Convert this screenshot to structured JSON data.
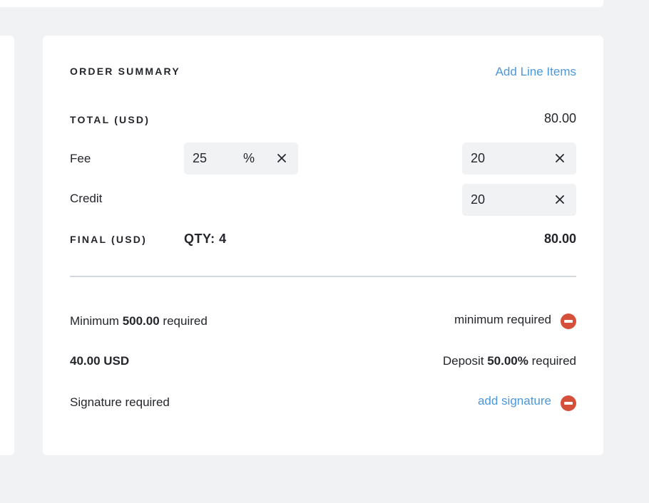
{
  "summary": {
    "title": "ORDER SUMMARY",
    "add_line_items_label": "Add Line Items",
    "total_label": "TOTAL (USD)",
    "total_value": "80.00",
    "fee": {
      "label": "Fee",
      "percent_value": "25",
      "percent_symbol": "%",
      "amount_value": "20"
    },
    "credit": {
      "label": "Credit",
      "amount_value": "20"
    },
    "final_label": "FINAL (USD)",
    "qty_label": "QTY: 4",
    "final_value": "80.00"
  },
  "requirements": {
    "minimum": {
      "prefix": "Minimum",
      "amount": "500.00",
      "suffix": "required",
      "status_text": "minimum required",
      "status_icon": "minus-circle-icon"
    },
    "deposit": {
      "amount_text": "40.00 USD",
      "prefix": "Deposit",
      "percent": "50.00%",
      "suffix": "required"
    },
    "signature": {
      "label": "Signature required",
      "action_label": "add signature",
      "status_icon": "minus-circle-icon"
    }
  },
  "colors": {
    "accent_link": "#4a98dc",
    "error_icon": "#d4503a",
    "background": "#f1f2f4",
    "panel": "#ffffff",
    "input_bg": "#f1f2f4",
    "divider": "#d4d7db",
    "text": "#24262b"
  }
}
